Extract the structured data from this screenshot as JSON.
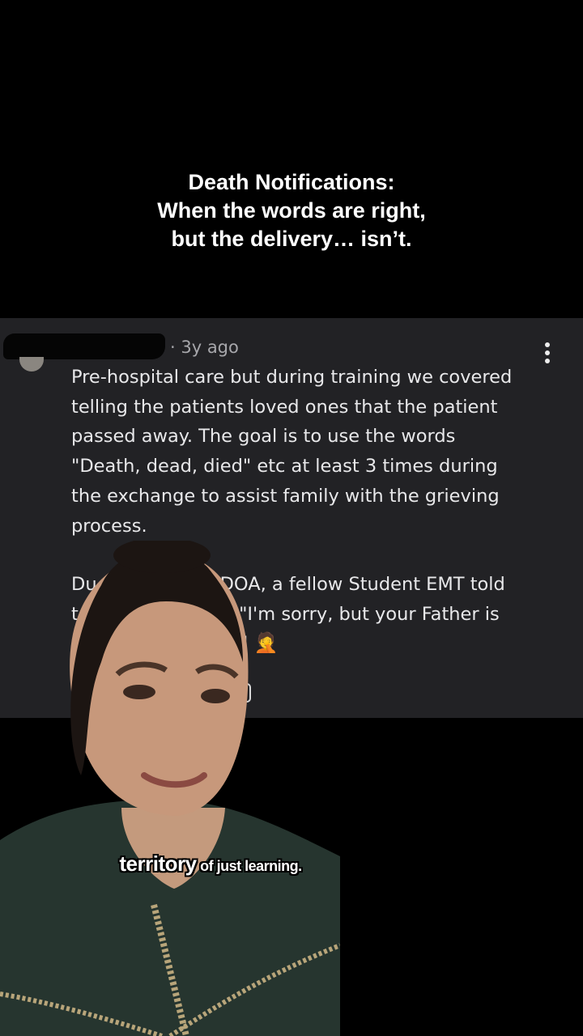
{
  "overlay_title": {
    "lines": [
      "Death Notifications:",
      "When the words are right,",
      "but the delivery… isn’t."
    ]
  },
  "comment": {
    "meta": "· 3y ago",
    "paragraph1": [
      "Pre-hospital care but during training we covered",
      "telling the patients loved ones that the patient",
      "passed away. The goal is to use the words",
      "\"Death, dead, died\" etc at least 3 times during",
      "the exchange to assist family with the grieving",
      "process."
    ],
    "paragraph2_visible": {
      "line1_left": "Du",
      "line1_right": "DOA, a fellow Student EMT told",
      "line2_left": "t",
      "line2_right": "er \"I'm sorry, but your Father is",
      "line3_right": "\"",
      "emoji": "🤦"
    }
  },
  "caption": {
    "highlight": "territory",
    "rest": " of just learning."
  },
  "icons": {
    "more": "more-vertical-icon",
    "emoji": "face-palm-emoji"
  },
  "colors": {
    "background": "#000000",
    "panel": "#222225",
    "comment_text": "#e8e8ea",
    "meta_text": "#a7a7ab"
  }
}
